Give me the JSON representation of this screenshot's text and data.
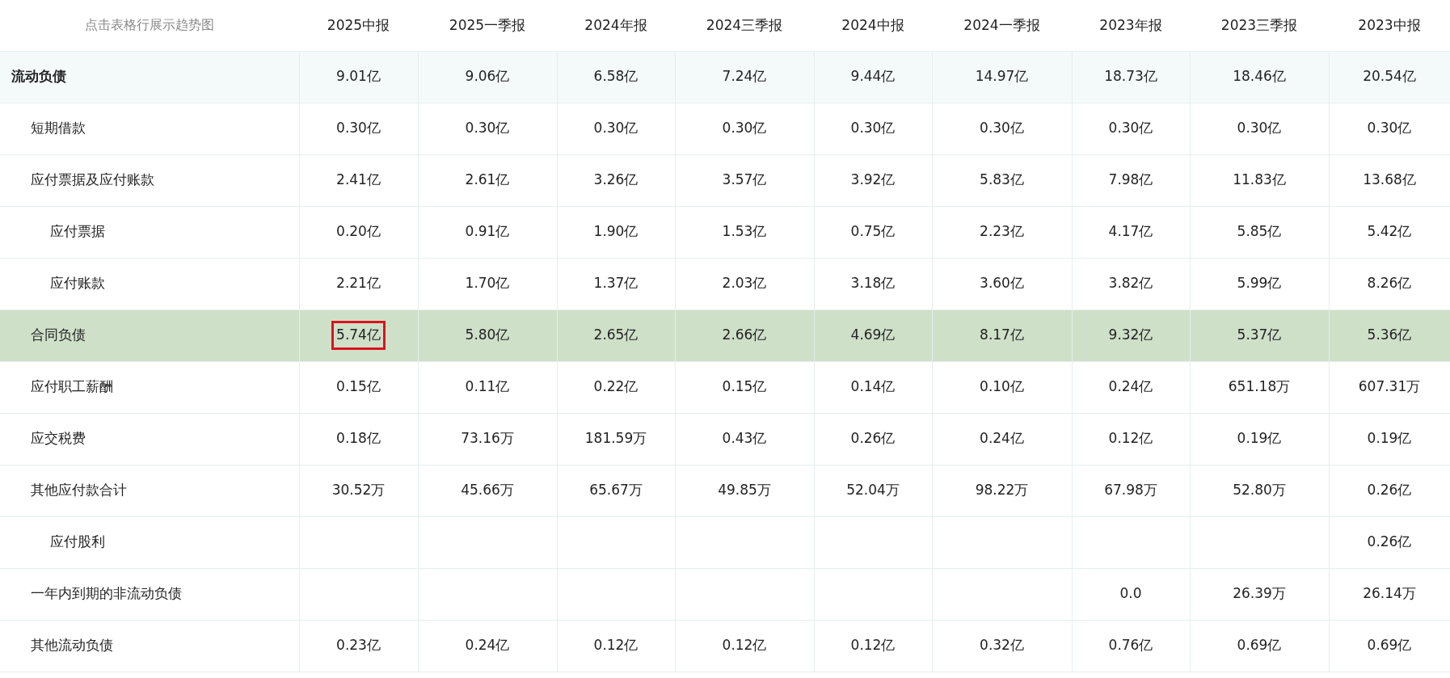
{
  "table": {
    "caption": "点击表格行展示趋势图",
    "columns": [
      "2025中报",
      "2025一季报",
      "2024年报",
      "2024三季报",
      "2024中报",
      "2024一季报",
      "2023年报",
      "2023三季报",
      "2023中报"
    ],
    "rows": [
      {
        "label": "流动负债",
        "selected": false,
        "cells": [
          {
            "text": "9.01亿",
            "marked": false
          },
          {
            "text": "9.06亿",
            "marked": false
          },
          {
            "text": "6.58亿",
            "marked": false
          },
          {
            "text": "7.24亿",
            "marked": false
          },
          {
            "text": "9.44亿",
            "marked": false
          },
          {
            "text": "14.97亿",
            "marked": false
          },
          {
            "text": "18.73亿",
            "marked": false
          },
          {
            "text": "18.46亿",
            "marked": false
          },
          {
            "text": "20.54亿",
            "marked": false
          }
        ],
        "children": [
          {
            "label": "短期借款",
            "selected": false,
            "cells": [
              {
                "text": "0.30亿",
                "marked": false
              },
              {
                "text": "0.30亿",
                "marked": false
              },
              {
                "text": "0.30亿",
                "marked": false
              },
              {
                "text": "0.30亿",
                "marked": false
              },
              {
                "text": "0.30亿",
                "marked": false
              },
              {
                "text": "0.30亿",
                "marked": false
              },
              {
                "text": "0.30亿",
                "marked": false
              },
              {
                "text": "0.30亿",
                "marked": false
              },
              {
                "text": "0.30亿",
                "marked": false
              }
            ]
          },
          {
            "label": "应付票据及应付账款",
            "selected": false,
            "cells": [
              {
                "text": "2.41亿",
                "marked": false
              },
              {
                "text": "2.61亿",
                "marked": false
              },
              {
                "text": "3.26亿",
                "marked": false
              },
              {
                "text": "3.57亿",
                "marked": false
              },
              {
                "text": "3.92亿",
                "marked": false
              },
              {
                "text": "5.83亿",
                "marked": false
              },
              {
                "text": "7.98亿",
                "marked": false
              },
              {
                "text": "11.83亿",
                "marked": false
              },
              {
                "text": "13.68亿",
                "marked": false
              }
            ],
            "children": [
              {
                "label": "应付票据",
                "selected": false,
                "cells": [
                  {
                    "text": "0.20亿",
                    "marked": false
                  },
                  {
                    "text": "0.91亿",
                    "marked": false
                  },
                  {
                    "text": "1.90亿",
                    "marked": false
                  },
                  {
                    "text": "1.53亿",
                    "marked": false
                  },
                  {
                    "text": "0.75亿",
                    "marked": false
                  },
                  {
                    "text": "2.23亿",
                    "marked": false
                  },
                  {
                    "text": "4.17亿",
                    "marked": false
                  },
                  {
                    "text": "5.85亿",
                    "marked": false
                  },
                  {
                    "text": "5.42亿",
                    "marked": false
                  }
                ]
              },
              {
                "label": "应付账款",
                "selected": false,
                "cells": [
                  {
                    "text": "2.21亿",
                    "marked": false
                  },
                  {
                    "text": "1.70亿",
                    "marked": false
                  },
                  {
                    "text": "1.37亿",
                    "marked": false
                  },
                  {
                    "text": "2.03亿",
                    "marked": false
                  },
                  {
                    "text": "3.18亿",
                    "marked": false
                  },
                  {
                    "text": "3.60亿",
                    "marked": false
                  },
                  {
                    "text": "3.82亿",
                    "marked": false
                  },
                  {
                    "text": "5.99亿",
                    "marked": false
                  },
                  {
                    "text": "8.26亿",
                    "marked": false
                  }
                ]
              }
            ]
          },
          {
            "label": "合同负债",
            "selected": true,
            "cells": [
              {
                "text": "5.74亿",
                "marked": true
              },
              {
                "text": "5.80亿",
                "marked": false
              },
              {
                "text": "2.65亿",
                "marked": false
              },
              {
                "text": "2.66亿",
                "marked": false
              },
              {
                "text": "4.69亿",
                "marked": false
              },
              {
                "text": "8.17亿",
                "marked": false
              },
              {
                "text": "9.32亿",
                "marked": false
              },
              {
                "text": "5.37亿",
                "marked": false
              },
              {
                "text": "5.36亿",
                "marked": false
              }
            ]
          },
          {
            "label": "应付职工薪酬",
            "selected": false,
            "cells": [
              {
                "text": "0.15亿",
                "marked": false
              },
              {
                "text": "0.11亿",
                "marked": false
              },
              {
                "text": "0.22亿",
                "marked": false
              },
              {
                "text": "0.15亿",
                "marked": false
              },
              {
                "text": "0.14亿",
                "marked": false
              },
              {
                "text": "0.10亿",
                "marked": false
              },
              {
                "text": "0.24亿",
                "marked": false
              },
              {
                "text": "651.18万",
                "marked": false
              },
              {
                "text": "607.31万",
                "marked": false
              }
            ]
          },
          {
            "label": "应交税费",
            "selected": false,
            "cells": [
              {
                "text": "0.18亿",
                "marked": false
              },
              {
                "text": "73.16万",
                "marked": false
              },
              {
                "text": "181.59万",
                "marked": false
              },
              {
                "text": "0.43亿",
                "marked": false
              },
              {
                "text": "0.26亿",
                "marked": false
              },
              {
                "text": "0.24亿",
                "marked": false
              },
              {
                "text": "0.12亿",
                "marked": false
              },
              {
                "text": "0.19亿",
                "marked": false
              },
              {
                "text": "0.19亿",
                "marked": false
              }
            ]
          },
          {
            "label": "其他应付款合计",
            "selected": false,
            "cells": [
              {
                "text": "30.52万",
                "marked": false
              },
              {
                "text": "45.66万",
                "marked": false
              },
              {
                "text": "65.67万",
                "marked": false
              },
              {
                "text": "49.85万",
                "marked": false
              },
              {
                "text": "52.04万",
                "marked": false
              },
              {
                "text": "98.22万",
                "marked": false
              },
              {
                "text": "67.98万",
                "marked": false
              },
              {
                "text": "52.80万",
                "marked": false
              },
              {
                "text": "0.26亿",
                "marked": false
              }
            ],
            "children": [
              {
                "label": "应付股利",
                "selected": false,
                "cells": [
                  {
                    "marked": false
                  },
                  {
                    "marked": false
                  },
                  {
                    "marked": false
                  },
                  {
                    "marked": false
                  },
                  {
                    "marked": false
                  },
                  {
                    "marked": false
                  },
                  {
                    "marked": false
                  },
                  {
                    "marked": false
                  },
                  {
                    "text": "0.26亿",
                    "marked": false
                  }
                ]
              }
            ]
          },
          {
            "label": "一年内到期的非流动负债",
            "selected": false,
            "cells": [
              {
                "marked": false
              },
              {
                "marked": false
              },
              {
                "marked": false
              },
              {
                "marked": false
              },
              {
                "marked": false
              },
              {
                "marked": false
              },
              {
                "text": "0.0",
                "marked": false
              },
              {
                "text": "26.39万",
                "marked": false
              },
              {
                "text": "26.14万",
                "marked": false
              }
            ]
          },
          {
            "label": "其他流动负债",
            "selected": false,
            "cells": [
              {
                "text": "0.23亿",
                "marked": false
              },
              {
                "text": "0.24亿",
                "marked": false
              },
              {
                "text": "0.12亿",
                "marked": false
              },
              {
                "text": "0.12亿",
                "marked": false
              },
              {
                "text": "0.12亿",
                "marked": false
              },
              {
                "text": "0.32亿",
                "marked": false
              },
              {
                "text": "0.76亿",
                "marked": false
              },
              {
                "text": "0.69亿",
                "marked": false
              },
              {
                "text": "0.69亿",
                "marked": false
              }
            ]
          }
        ]
      }
    ]
  }
}
